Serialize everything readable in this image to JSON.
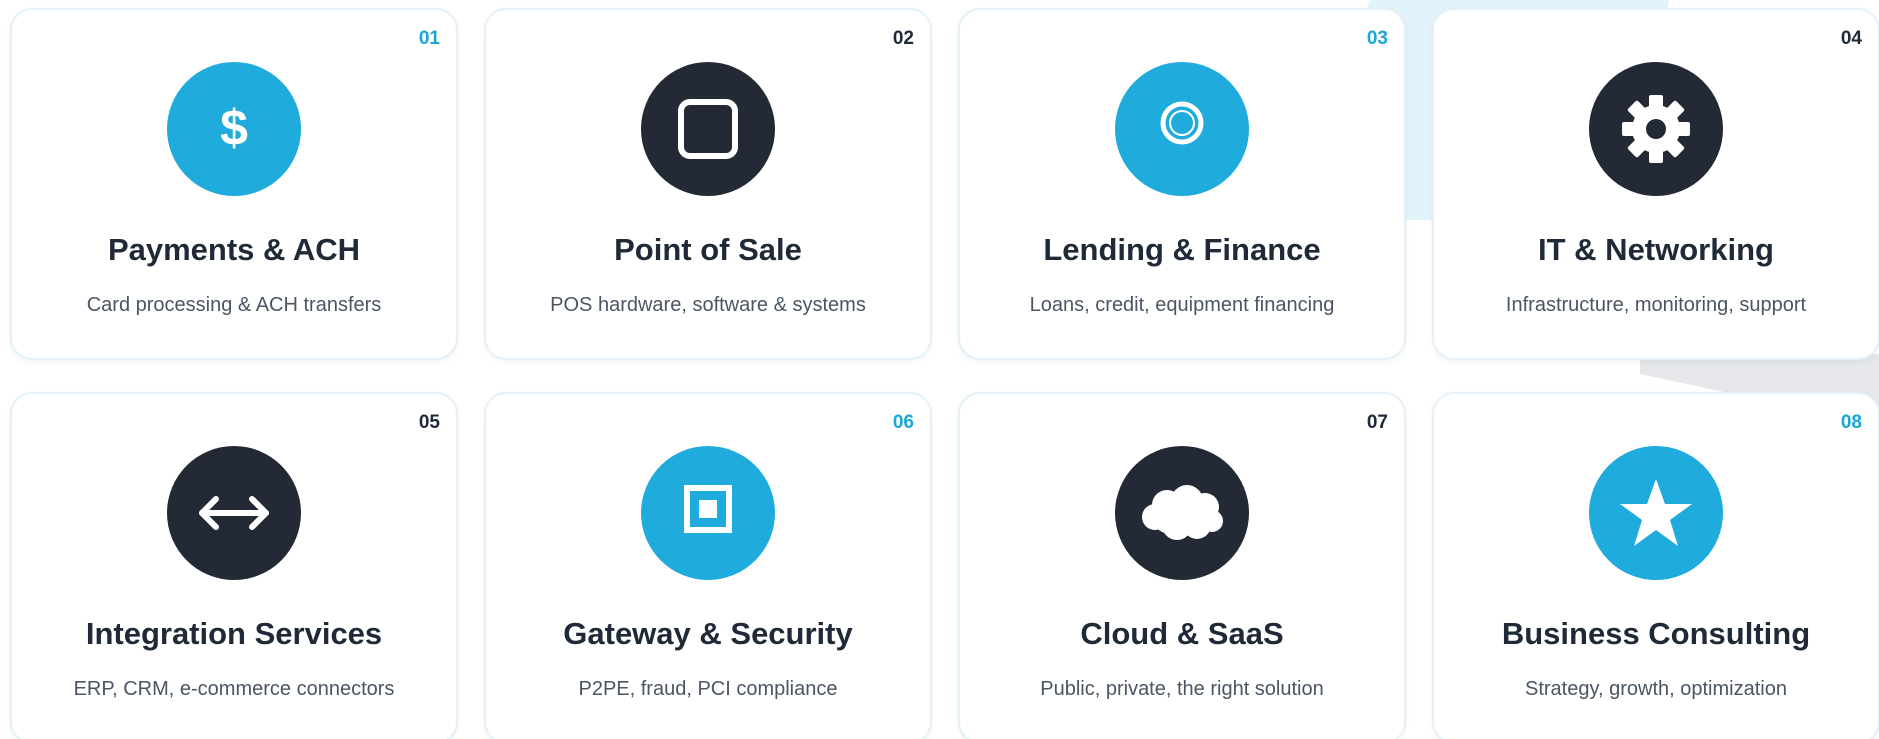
{
  "colors": {
    "accent": "#1fabdb",
    "dark": "#232a36",
    "title": "#1f2937",
    "text": "#4b5563",
    "card_border": "#e4f2f8"
  },
  "cards": [
    {
      "number": "01",
      "number_color": "blue",
      "icon": "dollar-icon",
      "icon_bg": "blue",
      "title": "Payments & ACH",
      "description": "Card processing & ACH transfers"
    },
    {
      "number": "02",
      "number_color": "dark",
      "icon": "square-icon",
      "icon_bg": "dark",
      "title": "Point of Sale",
      "description": "POS hardware, software & systems"
    },
    {
      "number": "03",
      "number_color": "blue",
      "icon": "ring-icon",
      "icon_bg": "blue",
      "title": "Lending & Finance",
      "description": "Loans, credit, equipment financing"
    },
    {
      "number": "04",
      "number_color": "dark",
      "icon": "gear-icon",
      "icon_bg": "dark",
      "title": "IT & Networking",
      "description": "Infrastructure, monitoring, support"
    },
    {
      "number": "05",
      "number_color": "dark",
      "icon": "arrows-horizontal-icon",
      "icon_bg": "dark",
      "title": "Integration Services",
      "description": "ERP, CRM, e-commerce connectors"
    },
    {
      "number": "06",
      "number_color": "blue",
      "icon": "shield-square-icon",
      "icon_bg": "blue",
      "title": "Gateway & Security",
      "description": "P2PE, fraud, PCI compliance"
    },
    {
      "number": "07",
      "number_color": "dark",
      "icon": "cloud-icon",
      "icon_bg": "dark",
      "title": "Cloud & SaaS",
      "description": "Public, private, the right solution"
    },
    {
      "number": "08",
      "number_color": "blue",
      "icon": "star-icon",
      "icon_bg": "blue",
      "title": "Business Consulting",
      "description": "Strategy, growth, optimization"
    }
  ]
}
